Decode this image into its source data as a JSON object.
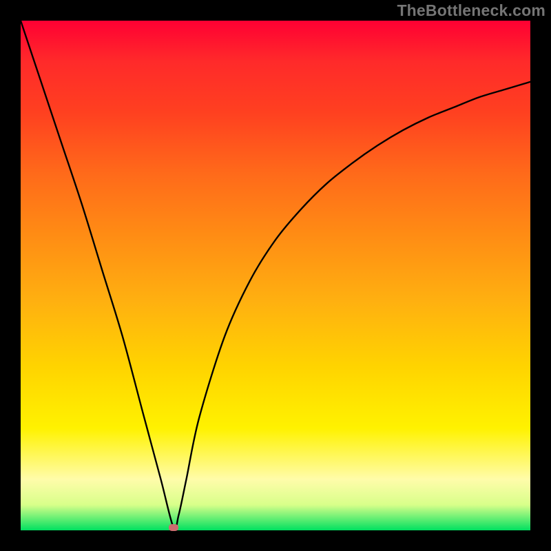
{
  "watermark": "TheBottleneck.com",
  "colors": {
    "frame": "#000000",
    "curve": "#000000",
    "marker": "#cc6d6f"
  },
  "chart_data": {
    "type": "line",
    "title": "",
    "xlabel": "",
    "ylabel": "",
    "xlim": [
      0,
      100
    ],
    "ylim": [
      0,
      100
    ],
    "grid": false,
    "legend": false,
    "notes": "Bottleneck-style curve: sharp dip to ~0 near x≈30, rises back; values estimated from pixels",
    "annotations": {
      "marker": {
        "x": 30,
        "y": 0.5
      }
    },
    "series": [
      {
        "name": "curve",
        "x": [
          0,
          4,
          8,
          12,
          16,
          20,
          24,
          27.5,
          30,
          31,
          32.5,
          35,
          40,
          45,
          50,
          55,
          60,
          65,
          70,
          75,
          80,
          85,
          90,
          95,
          100
        ],
        "values": [
          100,
          88,
          76,
          64,
          51,
          38,
          23,
          10,
          0.5,
          3,
          10,
          22,
          38,
          49,
          57,
          63,
          68,
          72,
          75.5,
          78.5,
          81,
          83,
          85,
          86.5,
          88
        ]
      }
    ]
  }
}
